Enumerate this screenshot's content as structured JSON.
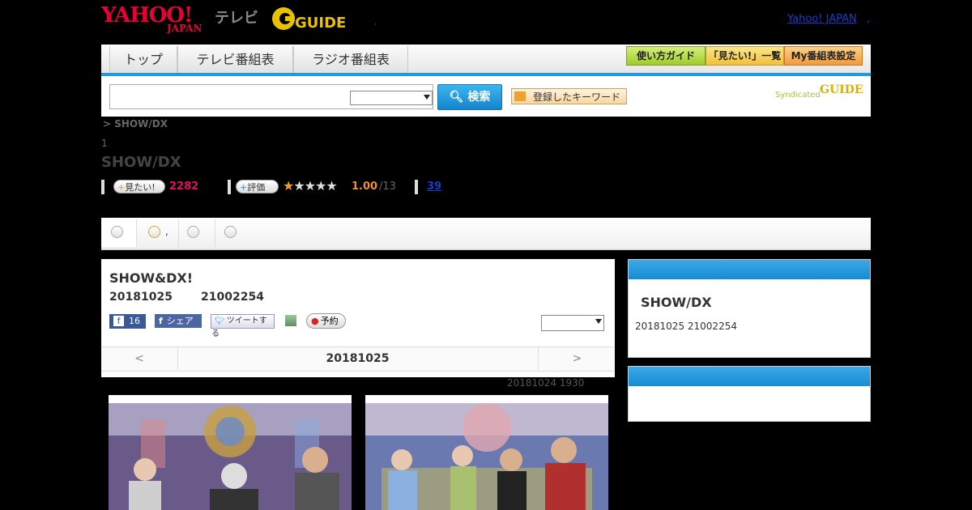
{
  "header": {
    "logo_yahoo": "YAHOO!",
    "logo_japan": "JAPAN",
    "logo_tv": "テレビ",
    "gguide_logo": "GUIDE",
    "top_link": "Yahoo! JAPAN",
    "top_dot": ",",
    "center_dot": ","
  },
  "nav": {
    "tabs": [
      "トップ",
      "テレビ番組表",
      "ラジオ番組表"
    ],
    "right_buttons": [
      "使い方ガイド",
      "「見たい!」一覧",
      "My番組表設定"
    ]
  },
  "search": {
    "button_label": "検索",
    "keyword_button": "登録したキーワード",
    "syndicated": "Syndicated",
    "input_value": "",
    "select_value": ""
  },
  "breadcrumb": "> SHOW/DX",
  "rank": "1",
  "program_title": "SHOW/DX",
  "stats": {
    "want_label": "見たい!",
    "want_count": "2282",
    "rate_label": "評価",
    "stars_filled": 1,
    "stars_total": 5,
    "score": "1.00",
    "score_count": "/13",
    "link_count": "39"
  },
  "tabs_bar": {
    "second_tab_suffix": ","
  },
  "program": {
    "title": "SHOW&DX!",
    "date": "20181025",
    "time": "21002254",
    "fb_like_count": "16",
    "fb_share": "シェア",
    "tweet": "ツイートする",
    "reserve": "予約",
    "date_nav": {
      "prev": "<",
      "current": "20181025",
      "next": ">"
    },
    "previous_air": "20181024  1930"
  },
  "sidebar": {
    "title": "SHOW/DX",
    "subtitle": "20181025  21002254"
  },
  "colors": {
    "accent": "#1e9be0",
    "brand_red": "#e60033",
    "count_red": "#e0115f"
  }
}
